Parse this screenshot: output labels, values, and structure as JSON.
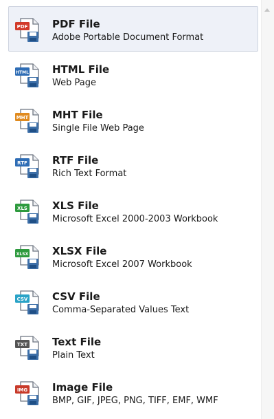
{
  "formats": [
    {
      "title": "PDF File",
      "description": "Adobe Portable Document Format",
      "icon": "pdf-file-icon",
      "badge": "PDF",
      "color": "#d23a2a",
      "selected": true
    },
    {
      "title": "HTML File",
      "description": "Web Page",
      "icon": "html-file-icon",
      "badge": "HTML",
      "color": "#2f6db5",
      "selected": false
    },
    {
      "title": "MHT File",
      "description": "Single File Web Page",
      "icon": "mht-file-icon",
      "badge": "MHT",
      "color": "#e08a1e",
      "selected": false
    },
    {
      "title": "RTF File",
      "description": "Rich Text Format",
      "icon": "rtf-file-icon",
      "badge": "RTF",
      "color": "#2f6db5",
      "selected": false
    },
    {
      "title": "XLS File",
      "description": "Microsoft Excel 2000-2003 Workbook",
      "icon": "xls-file-icon",
      "badge": "XLS",
      "color": "#2e9a3e",
      "selected": false
    },
    {
      "title": "XLSX File",
      "description": "Microsoft Excel 2007 Workbook",
      "icon": "xlsx-file-icon",
      "badge": "XLSX",
      "color": "#2e9a3e",
      "selected": false
    },
    {
      "title": "CSV File",
      "description": "Comma-Separated Values Text",
      "icon": "csv-file-icon",
      "badge": "CSV",
      "color": "#2aa3c7",
      "selected": false
    },
    {
      "title": "Text File",
      "description": "Plain Text",
      "icon": "text-file-icon",
      "badge": "TXT",
      "color": "#555555",
      "selected": false
    },
    {
      "title": "Image File",
      "description": "BMP, GIF, JPEG, PNG, TIFF, EMF, WMF",
      "icon": "image-file-icon",
      "badge": "IMG",
      "color": "#c83a2a",
      "selected": false
    }
  ],
  "colors": {
    "selected_background": "#eef1f8",
    "selected_border": "#cdd3df",
    "document_stroke": "#6c7480",
    "disk_color": "#3d6fa8"
  }
}
